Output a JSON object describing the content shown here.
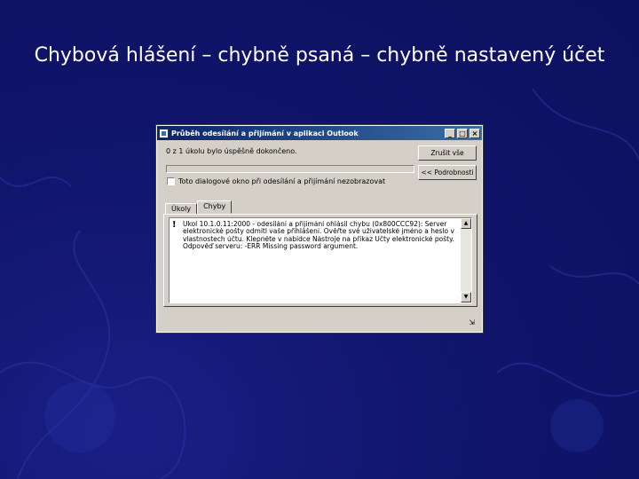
{
  "slide": {
    "title": "Chybová hlášení – chybně psaná – chybně nastavený účet"
  },
  "window": {
    "title": "Průběh odesílání a přijímání v aplikaci Outlook",
    "controls": {
      "minimize": "_",
      "maximize": "□",
      "close": "×"
    },
    "status_text": "0 z 1 úkolu bylo úspěšně dokončeno.",
    "progress": 0,
    "buttons": {
      "cancel_all": "Zrušit vše",
      "details": "<< Podrobnosti"
    },
    "checkbox": {
      "label": "Toto dialogové okno při odesílání a přijímání nezobrazovat",
      "checked": false
    },
    "tabs": [
      {
        "label": "Úkoly",
        "active": false
      },
      {
        "label": "Chyby",
        "active": true
      }
    ],
    "error": {
      "icon": "!",
      "lines": [
        "Úkol 10.1.0.11:2000 - odesílání a přijímání ohlásil chybu (0x800CCC92): Server",
        "elektronické pošty odmítl vaše přihlášení. Ověřte své uživatelské jméno a heslo v",
        "vlastnostech účtu. Klepněte v nabídce Nástroje na příkaz Účty elektronické pošty.",
        "Odpověď serveru: -ERR Missing password argument."
      ]
    },
    "scroll": {
      "up": "▲",
      "down": "▼"
    },
    "bottom_icon": "⇲"
  }
}
